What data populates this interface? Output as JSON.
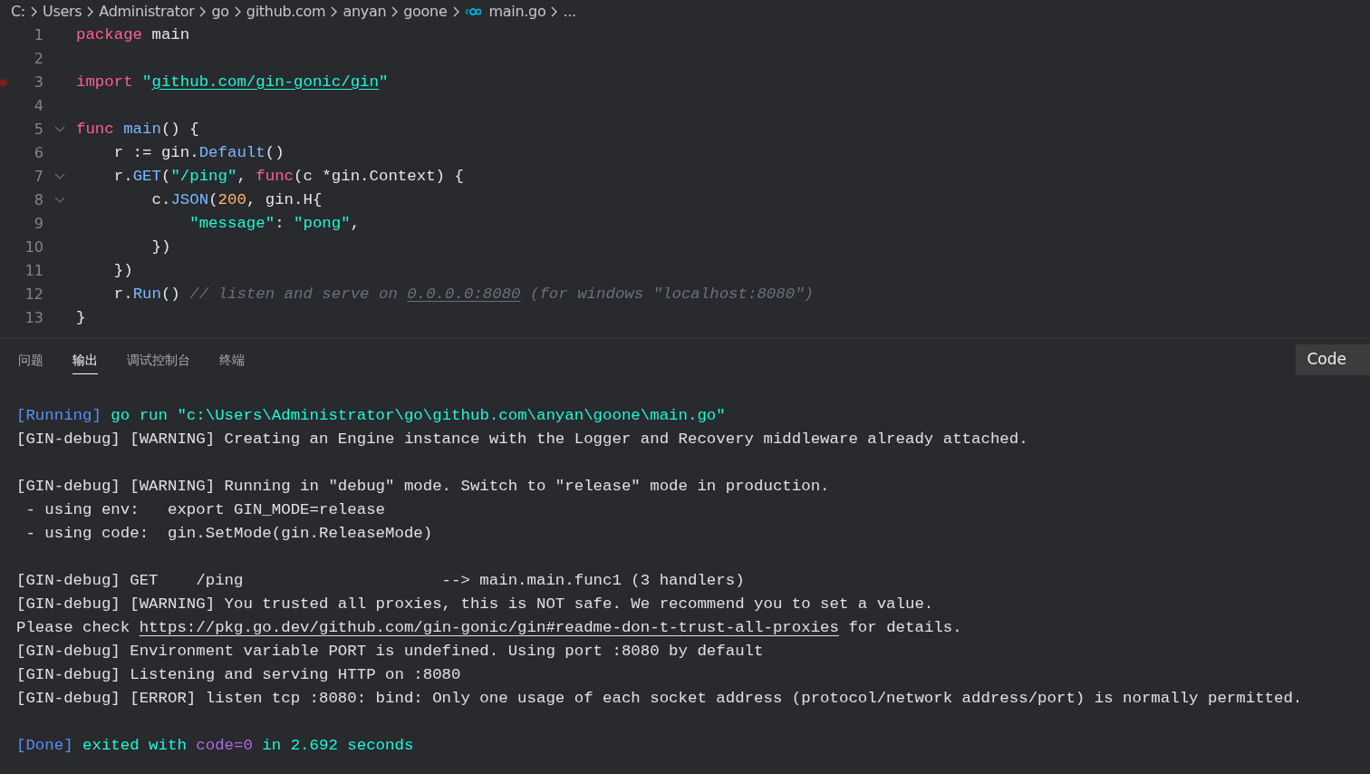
{
  "breadcrumb": {
    "items": [
      {
        "label": "C:",
        "kind": "folder"
      },
      {
        "label": "Users",
        "kind": "folder"
      },
      {
        "label": "Administrator",
        "kind": "folder"
      },
      {
        "label": "go",
        "kind": "folder"
      },
      {
        "label": "github.com",
        "kind": "folder"
      },
      {
        "label": "anyan",
        "kind": "folder"
      },
      {
        "label": "goone",
        "kind": "folder"
      },
      {
        "label": "main.go",
        "kind": "go-file"
      },
      {
        "label": "...",
        "kind": "more"
      }
    ]
  },
  "editor": {
    "lines": [
      {
        "number": "1",
        "breakpoint": false,
        "tokens": [
          {
            "kind": "keyword",
            "text": "package"
          },
          {
            "kind": "plain",
            "text": " main"
          }
        ]
      },
      {
        "number": "2",
        "breakpoint": false
      },
      {
        "number": "3",
        "breakpoint": true,
        "tokens": [
          {
            "kind": "keyword",
            "text": "import "
          },
          {
            "kind": "string",
            "text": "\""
          },
          {
            "kind": "string-link",
            "text": "github.com/gin-gonic/gin"
          },
          {
            "kind": "string",
            "text": "\""
          }
        ]
      },
      {
        "number": "4",
        "breakpoint": false
      },
      {
        "number": "5",
        "breakpoint": false,
        "expanded": true,
        "tokens": [
          {
            "kind": "keyword",
            "text": "func "
          },
          {
            "kind": "function",
            "text": "main"
          },
          {
            "kind": "plain",
            "text": "() {"
          }
        ]
      },
      {
        "number": "6",
        "breakpoint": false,
        "tokens": [
          {
            "kind": "plain",
            "text": "    r := gin."
          },
          {
            "kind": "function",
            "text": "Default"
          },
          {
            "kind": "plain",
            "text": "()"
          }
        ]
      },
      {
        "number": "7",
        "breakpoint": false,
        "expanded": true,
        "tokens": [
          {
            "kind": "plain",
            "text": "    r."
          },
          {
            "kind": "function",
            "text": "GET"
          },
          {
            "kind": "plain",
            "text": "("
          },
          {
            "kind": "string",
            "text": "\"/ping\""
          },
          {
            "kind": "plain",
            "text": ", "
          },
          {
            "kind": "keyword",
            "text": "func"
          },
          {
            "kind": "plain",
            "text": "(c *gin.Context) {"
          }
        ]
      },
      {
        "number": "8",
        "breakpoint": false,
        "expanded": true,
        "tokens": [
          {
            "kind": "plain",
            "text": "        c."
          },
          {
            "kind": "function",
            "text": "JSON"
          },
          {
            "kind": "plain",
            "text": "("
          },
          {
            "kind": "number",
            "text": "200"
          },
          {
            "kind": "plain",
            "text": ", gin.H{"
          }
        ]
      },
      {
        "number": "9",
        "breakpoint": false,
        "tokens": [
          {
            "kind": "string",
            "text": "            \"message\""
          },
          {
            "kind": "plain",
            "text": ": "
          },
          {
            "kind": "string",
            "text": "\"pong\""
          },
          {
            "kind": "plain",
            "text": ","
          }
        ]
      },
      {
        "number": "10",
        "breakpoint": false,
        "tokens": [
          {
            "kind": "plain",
            "text": "        })"
          }
        ]
      },
      {
        "number": "11",
        "breakpoint": false,
        "tokens": [
          {
            "kind": "plain",
            "text": "    })"
          }
        ]
      },
      {
        "number": "12",
        "breakpoint": false,
        "tokens": [
          {
            "kind": "plain",
            "text": "    r."
          },
          {
            "kind": "function",
            "text": "Run"
          },
          {
            "kind": "plain",
            "text": "() "
          },
          {
            "kind": "comment",
            "text": "// listen and serve on "
          },
          {
            "kind": "comment-link",
            "text": "0.0.0.0:8080"
          },
          {
            "kind": "comment",
            "text": " (for windows \"localhost:8080\")"
          }
        ]
      },
      {
        "number": "13",
        "breakpoint": false,
        "tokens": [
          {
            "kind": "plain",
            "text": "}"
          }
        ]
      }
    ]
  },
  "panel": {
    "tabs": [
      {
        "label": "问题",
        "selected": false
      },
      {
        "label": "输出",
        "selected": true
      },
      {
        "label": "调试控制台",
        "selected": false
      },
      {
        "label": "终端",
        "selected": false
      }
    ],
    "channel": "Code",
    "output": [
      {
        "kind": "text",
        "segments": [
          {
            "kind": "tag",
            "text": "[Running]"
          },
          {
            "kind": "accent",
            "text": " go run \"c:\\Users\\Administrator\\go\\github.com\\anyan\\goone\\main.go\""
          }
        ]
      },
      {
        "kind": "text",
        "segments": [
          {
            "kind": "plain",
            "text": "[GIN-debug] [WARNING] Creating an Engine instance with the Logger and Recovery middleware already attached."
          }
        ]
      },
      {
        "kind": "blank"
      },
      {
        "kind": "text",
        "segments": [
          {
            "kind": "plain",
            "text": "[GIN-debug] [WARNING] Running in \"debug\" mode. Switch to \"release\" mode in production."
          }
        ]
      },
      {
        "kind": "text",
        "segments": [
          {
            "kind": "plain",
            "text": " - using env:   export GIN_MODE=release"
          }
        ]
      },
      {
        "kind": "text",
        "segments": [
          {
            "kind": "plain",
            "text": " - using code:  gin.SetMode(gin.ReleaseMode)"
          }
        ]
      },
      {
        "kind": "blank"
      },
      {
        "kind": "text",
        "segments": [
          {
            "kind": "plain",
            "text": "[GIN-debug] GET    /ping                     --> main.main.func1 (3 handlers)"
          }
        ]
      },
      {
        "kind": "text",
        "segments": [
          {
            "kind": "plain",
            "text": "[GIN-debug] [WARNING] You trusted all proxies, this is NOT safe. We recommend you to set a value."
          }
        ]
      },
      {
        "kind": "text",
        "segments": [
          {
            "kind": "plain",
            "text": "Please check "
          },
          {
            "kind": "link",
            "text": "https://pkg.go.dev/github.com/gin-gonic/gin#readme-don-t-trust-all-proxies"
          },
          {
            "kind": "plain",
            "text": " for details."
          }
        ]
      },
      {
        "kind": "text",
        "segments": [
          {
            "kind": "plain",
            "text": "[GIN-debug] Environment variable PORT is undefined. Using port :8080 by default"
          }
        ]
      },
      {
        "kind": "text",
        "segments": [
          {
            "kind": "plain",
            "text": "[GIN-debug] Listening and serving HTTP on :8080"
          }
        ]
      },
      {
        "kind": "text",
        "segments": [
          {
            "kind": "plain",
            "text": "[GIN-debug] [ERROR] listen tcp :8080: bind: Only one usage of each socket address (protocol/network address/port) is normally permitted."
          }
        ]
      },
      {
        "kind": "blank"
      },
      {
        "kind": "text",
        "segments": [
          {
            "kind": "tag",
            "text": "[Done]"
          },
          {
            "kind": "accent",
            "text": " exited with "
          },
          {
            "kind": "purple",
            "text": "code=0"
          },
          {
            "kind": "accent",
            "text": " in 2.692 seconds"
          }
        ]
      }
    ]
  }
}
